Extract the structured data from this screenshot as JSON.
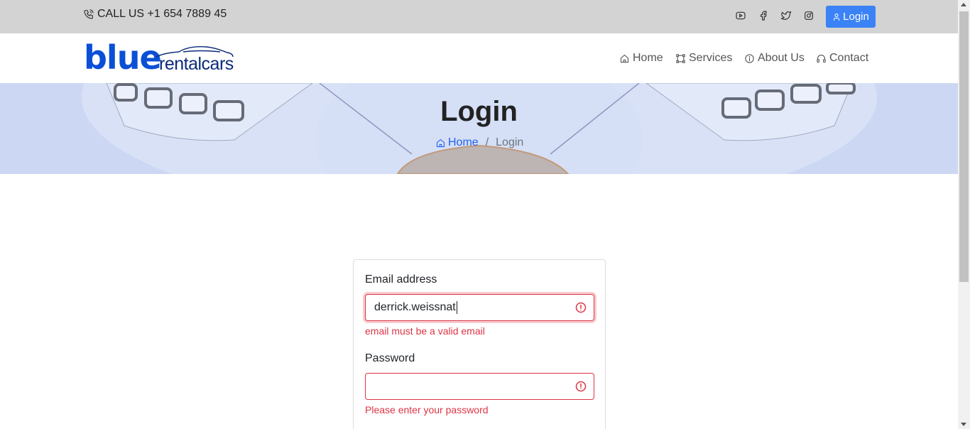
{
  "topbar": {
    "phone_text": "CALL US +1 654 7889 45",
    "social": [
      "youtube-icon",
      "facebook-icon",
      "twitter-icon",
      "instagram-icon"
    ],
    "login_label": "Login"
  },
  "brand": {
    "word_blue": "blue",
    "word_rental": "rentalcars"
  },
  "nav": {
    "items": [
      {
        "label": "Home",
        "icon": "home-icon"
      },
      {
        "label": "Services",
        "icon": "services-icon"
      },
      {
        "label": "About Us",
        "icon": "info-icon"
      },
      {
        "label": "Contact",
        "icon": "headset-icon"
      }
    ]
  },
  "hero": {
    "title": "Login",
    "breadcrumb": {
      "home": "Home",
      "separator": "/",
      "current": "Login"
    }
  },
  "form": {
    "email_label": "Email address",
    "email_value": "derrick.weissnat",
    "email_error": "email must be a valid email",
    "password_label": "Password",
    "password_value": "",
    "password_error": "Please enter your password"
  },
  "colors": {
    "accent": "#3b82f6",
    "brand_blue": "#0b4fd6",
    "error": "#dc3545",
    "topbar_bg": "#d3d3d3"
  }
}
